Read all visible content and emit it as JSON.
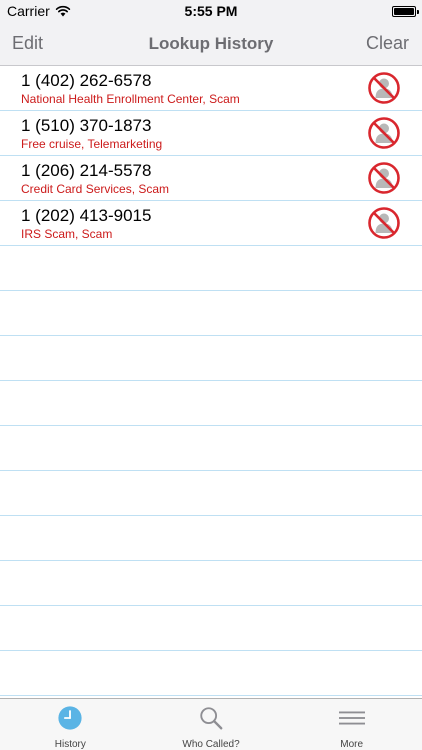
{
  "status_bar": {
    "carrier": "Carrier",
    "time": "5:55 PM"
  },
  "nav": {
    "edit_label": "Edit",
    "title": "Lookup History",
    "clear_label": "Clear"
  },
  "history": [
    {
      "number": "1 (402) 262-6578",
      "description": "National Health Enrollment Center, Scam",
      "icon": "blocked-caller-icon"
    },
    {
      "number": "1 (510) 370-1873",
      "description": "Free cruise, Telemarketing",
      "icon": "blocked-caller-icon"
    },
    {
      "number": "1 (206) 214-5578",
      "description": "Credit Card Services, Scam",
      "icon": "blocked-caller-icon"
    },
    {
      "number": "1 (202) 413-9015",
      "description": "IRS Scam, Scam",
      "icon": "blocked-caller-icon"
    }
  ],
  "tabs": [
    {
      "label": "History",
      "icon": "clock-icon",
      "active": true
    },
    {
      "label": "Who Called?",
      "icon": "search-icon",
      "active": false
    },
    {
      "label": "More",
      "icon": "menu-icon",
      "active": false
    }
  ],
  "colors": {
    "description_red": "#cc1b1b",
    "tab_active": "#5ab4e5",
    "line_blue": "#bfe0f3"
  }
}
